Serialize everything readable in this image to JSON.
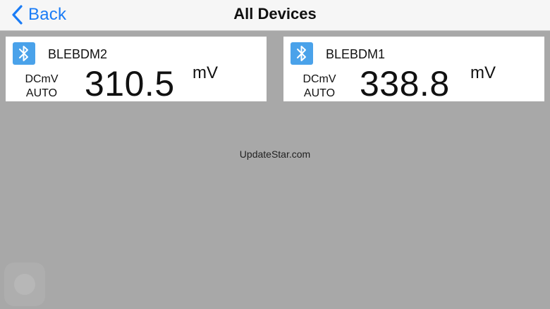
{
  "navbar": {
    "back_label": "Back",
    "title": "All Devices"
  },
  "devices": [
    {
      "name": "BLEBDM2",
      "mode": "DCmV",
      "range": "AUTO",
      "reading": "310.5",
      "unit": "mV",
      "icon": "bluetooth-icon"
    },
    {
      "name": "BLEBDM1",
      "mode": "DCmV",
      "range": "AUTO",
      "reading": "338.8",
      "unit": "mV",
      "icon": "bluetooth-icon"
    }
  ],
  "watermark": "UpdateStar.com",
  "colors": {
    "background": "#a8a8a8",
    "navbar": "#f6f6f6",
    "accent": "#1a7cf6",
    "bluetooth_tile": "#4aa2ea"
  }
}
